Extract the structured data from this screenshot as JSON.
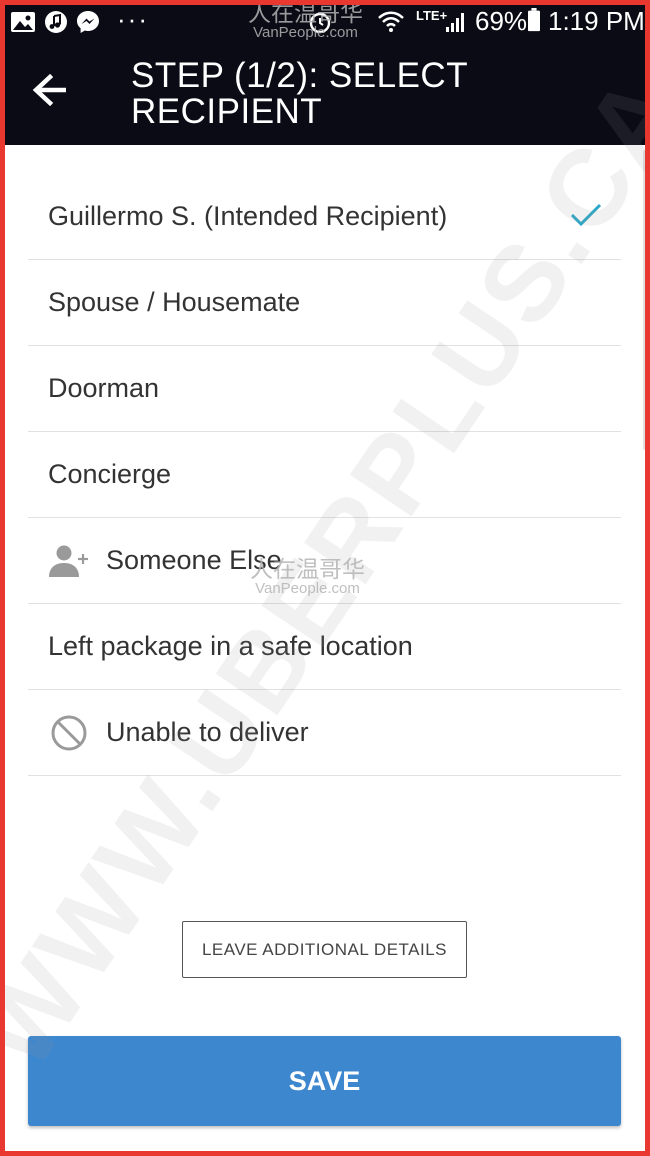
{
  "status_bar": {
    "icons": [
      "image-icon",
      "music-icon",
      "messenger-icon",
      "more-dots-icon",
      "alarm-icon",
      "wifi-icon",
      "signal-icon",
      "battery-icon"
    ],
    "network": "LTE+",
    "battery": "69%",
    "time": "1:19 PM"
  },
  "header": {
    "title": "STEP (1/2): SELECT RECIPIENT",
    "back_icon": "arrow-left-icon"
  },
  "recipients": [
    {
      "label": "Guillermo S. (Intended Recipient)",
      "icon": null,
      "selected": true
    },
    {
      "label": "Spouse / Housemate",
      "icon": null,
      "selected": false
    },
    {
      "label": "Doorman",
      "icon": null,
      "selected": false
    },
    {
      "label": "Concierge",
      "icon": null,
      "selected": false
    },
    {
      "label": "Someone Else",
      "icon": "add-person-icon",
      "selected": false
    },
    {
      "label": "Left package in a safe location",
      "icon": null,
      "selected": false
    },
    {
      "label": "Unable to deliver",
      "icon": "block-icon",
      "selected": false
    }
  ],
  "buttons": {
    "details_label": "LEAVE ADDITIONAL DETAILS",
    "save_label": "SAVE"
  },
  "watermarks": {
    "diagonal": "WWW.UBERPLUS.CA",
    "logo_cn": "人在温哥华",
    "logo_en": "VanPeople.com"
  },
  "colors": {
    "header_bg": "#0b0b16",
    "accent_check": "#2aa7c9",
    "save_bg": "#3d87ce",
    "frame_border": "#e8382f"
  }
}
